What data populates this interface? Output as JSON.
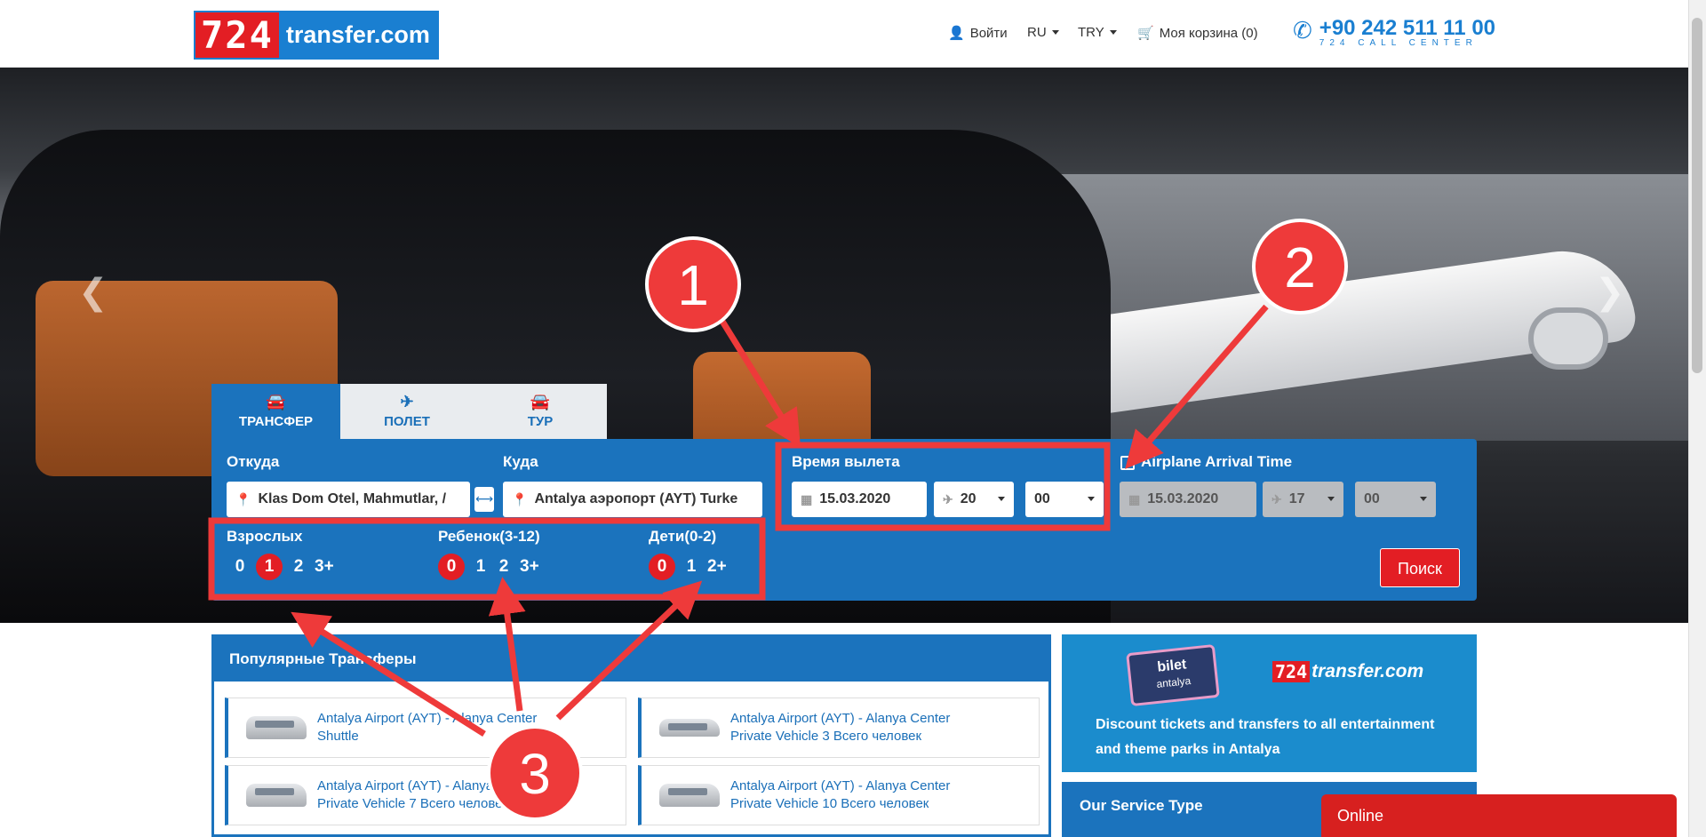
{
  "header": {
    "logo_number": "724",
    "logo_text": "transfer.com",
    "login_label": "Войти",
    "language": "RU",
    "currency": "TRY",
    "cart_label": "Моя корзина (0)",
    "phone": "+90 242 511 11 00",
    "phone_sub": "724 CALL CENTER"
  },
  "tabs": [
    {
      "label": "ТРАНСФЕР",
      "icon": "car-icon"
    },
    {
      "label": "ПОЛЕТ",
      "icon": "plane-icon"
    },
    {
      "label": "ТУР",
      "icon": "bus-icon"
    }
  ],
  "search": {
    "from_label": "Откуда",
    "from_value": "Klas Dom Otel, Mahmutlar, /",
    "to_label": "Куда",
    "to_value": "Antalya аэропорт (AYT) Turke",
    "departure_label": "Время вылета",
    "departure_date": "15.03.2020",
    "departure_hour": "20",
    "departure_minute": "00",
    "arrival_label": "Airplane Arrival Time",
    "arrival_date": "15.03.2020",
    "arrival_hour": "17",
    "arrival_minute": "00",
    "adults_label": "Взрослых",
    "adults_options": [
      "0",
      "1",
      "2",
      "3+"
    ],
    "adults_selected": "1",
    "child_label": "Ребенок(3-12)",
    "child_options": [
      "0",
      "1",
      "2",
      "3+"
    ],
    "child_selected": "0",
    "infant_label": "Дети(0-2)",
    "infant_options": [
      "0",
      "1",
      "2+"
    ],
    "infant_selected": "0",
    "search_button": "Поиск"
  },
  "popular": {
    "title": "Популярные Трансферы",
    "routes": [
      {
        "line1": "Antalya Airport (AYT) - Alanya Center",
        "line2": "Shuttle"
      },
      {
        "line1": "Antalya Airport (AYT) - Alanya Center",
        "line2": "Private Vehicle 3 Всего человек"
      },
      {
        "line1": "Antalya Airport (AYT) - Alanya",
        "line2": "Private Vehicle 7 Всего человек"
      },
      {
        "line1": "Antalya Airport (AYT) - Alanya Center",
        "line2": "Private Vehicle 10 Всего человек"
      }
    ]
  },
  "promo": {
    "bilet_title": "bilet",
    "bilet_sub": "antalya",
    "logo_number": "724",
    "logo_text": "transfer.com",
    "text": "Discount tickets and transfers to all entertainment and theme parks in Antalya"
  },
  "service": {
    "title": "Our Service Type"
  },
  "chat": {
    "label": "Online"
  },
  "annotations": {
    "one": "1",
    "two": "2",
    "three": "3"
  },
  "colors": {
    "primary": "#1b73bd",
    "accent": "#e31e24",
    "annotation": "#ee3a3a"
  }
}
